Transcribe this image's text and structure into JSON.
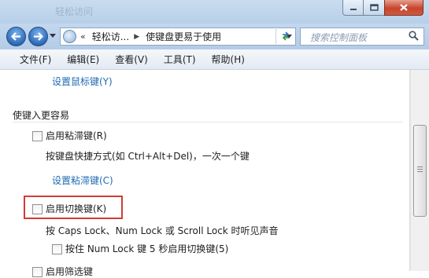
{
  "window": {
    "ghost_title": "轻松访问"
  },
  "nav": {
    "breadcrumb_prefix": "«",
    "breadcrumb_1": "轻松访...",
    "breadcrumb_2": "使键盘更易于使用",
    "search_placeholder": "搜索控制面板"
  },
  "menu": [
    "文件(F)",
    "编辑(E)",
    "查看(V)",
    "工具(T)",
    "帮助(H)"
  ],
  "content": {
    "mouse_keys_link": "设置鼠标键(Y)",
    "section_title": "使键入更容易",
    "sticky_keys": {
      "label": "启用粘滞键(R)",
      "checked": false
    },
    "sticky_desc": "按键盘快捷方式(如 Ctrl+Alt+Del)，一次一个键",
    "sticky_link": "设置粘滞键(C)",
    "toggle_keys": {
      "label": "启用切换键(K)",
      "checked": false
    },
    "toggle_desc": "按 Caps Lock、Num Lock 或 Scroll Lock 时听见声音",
    "toggle_hold": {
      "label": "按住 Num Lock 键 5 秒启用切换键(5)",
      "checked": false
    },
    "filter_keys": {
      "label": "启用筛选键"
    }
  },
  "colors": {
    "link": "#1f6ab4",
    "highlight": "#d03d35"
  }
}
